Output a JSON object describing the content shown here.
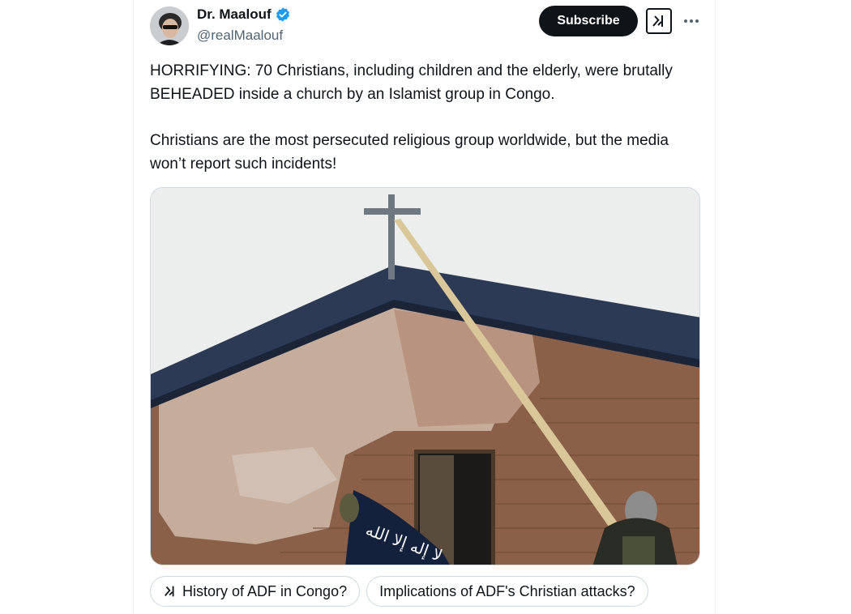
{
  "author": {
    "name": "Dr. Maalouf",
    "handle": "@realMaalouf",
    "verified_icon": "verified-badge-icon",
    "verified_color": "#1d9bf0"
  },
  "actions": {
    "subscribe_label": "Subscribe",
    "grok_icon": "grok-icon",
    "more_icon": "more-icon"
  },
  "post": {
    "paragraph_1": "HORRIFYING: 70 Christians, including children and the elderly, were brutally BEHEADED inside a church by an Islamist group in Congo.",
    "paragraph_2": "Christians are the most persecuted religious group worldwide, but the media won’t report such incidents!"
  },
  "media": {
    "flag_text": "لا إله إلا الله"
  },
  "suggestions": [
    {
      "label": "History of ADF in Congo?",
      "icon": "grok-icon"
    },
    {
      "label": "Implications of ADF's Christian attacks?"
    }
  ]
}
